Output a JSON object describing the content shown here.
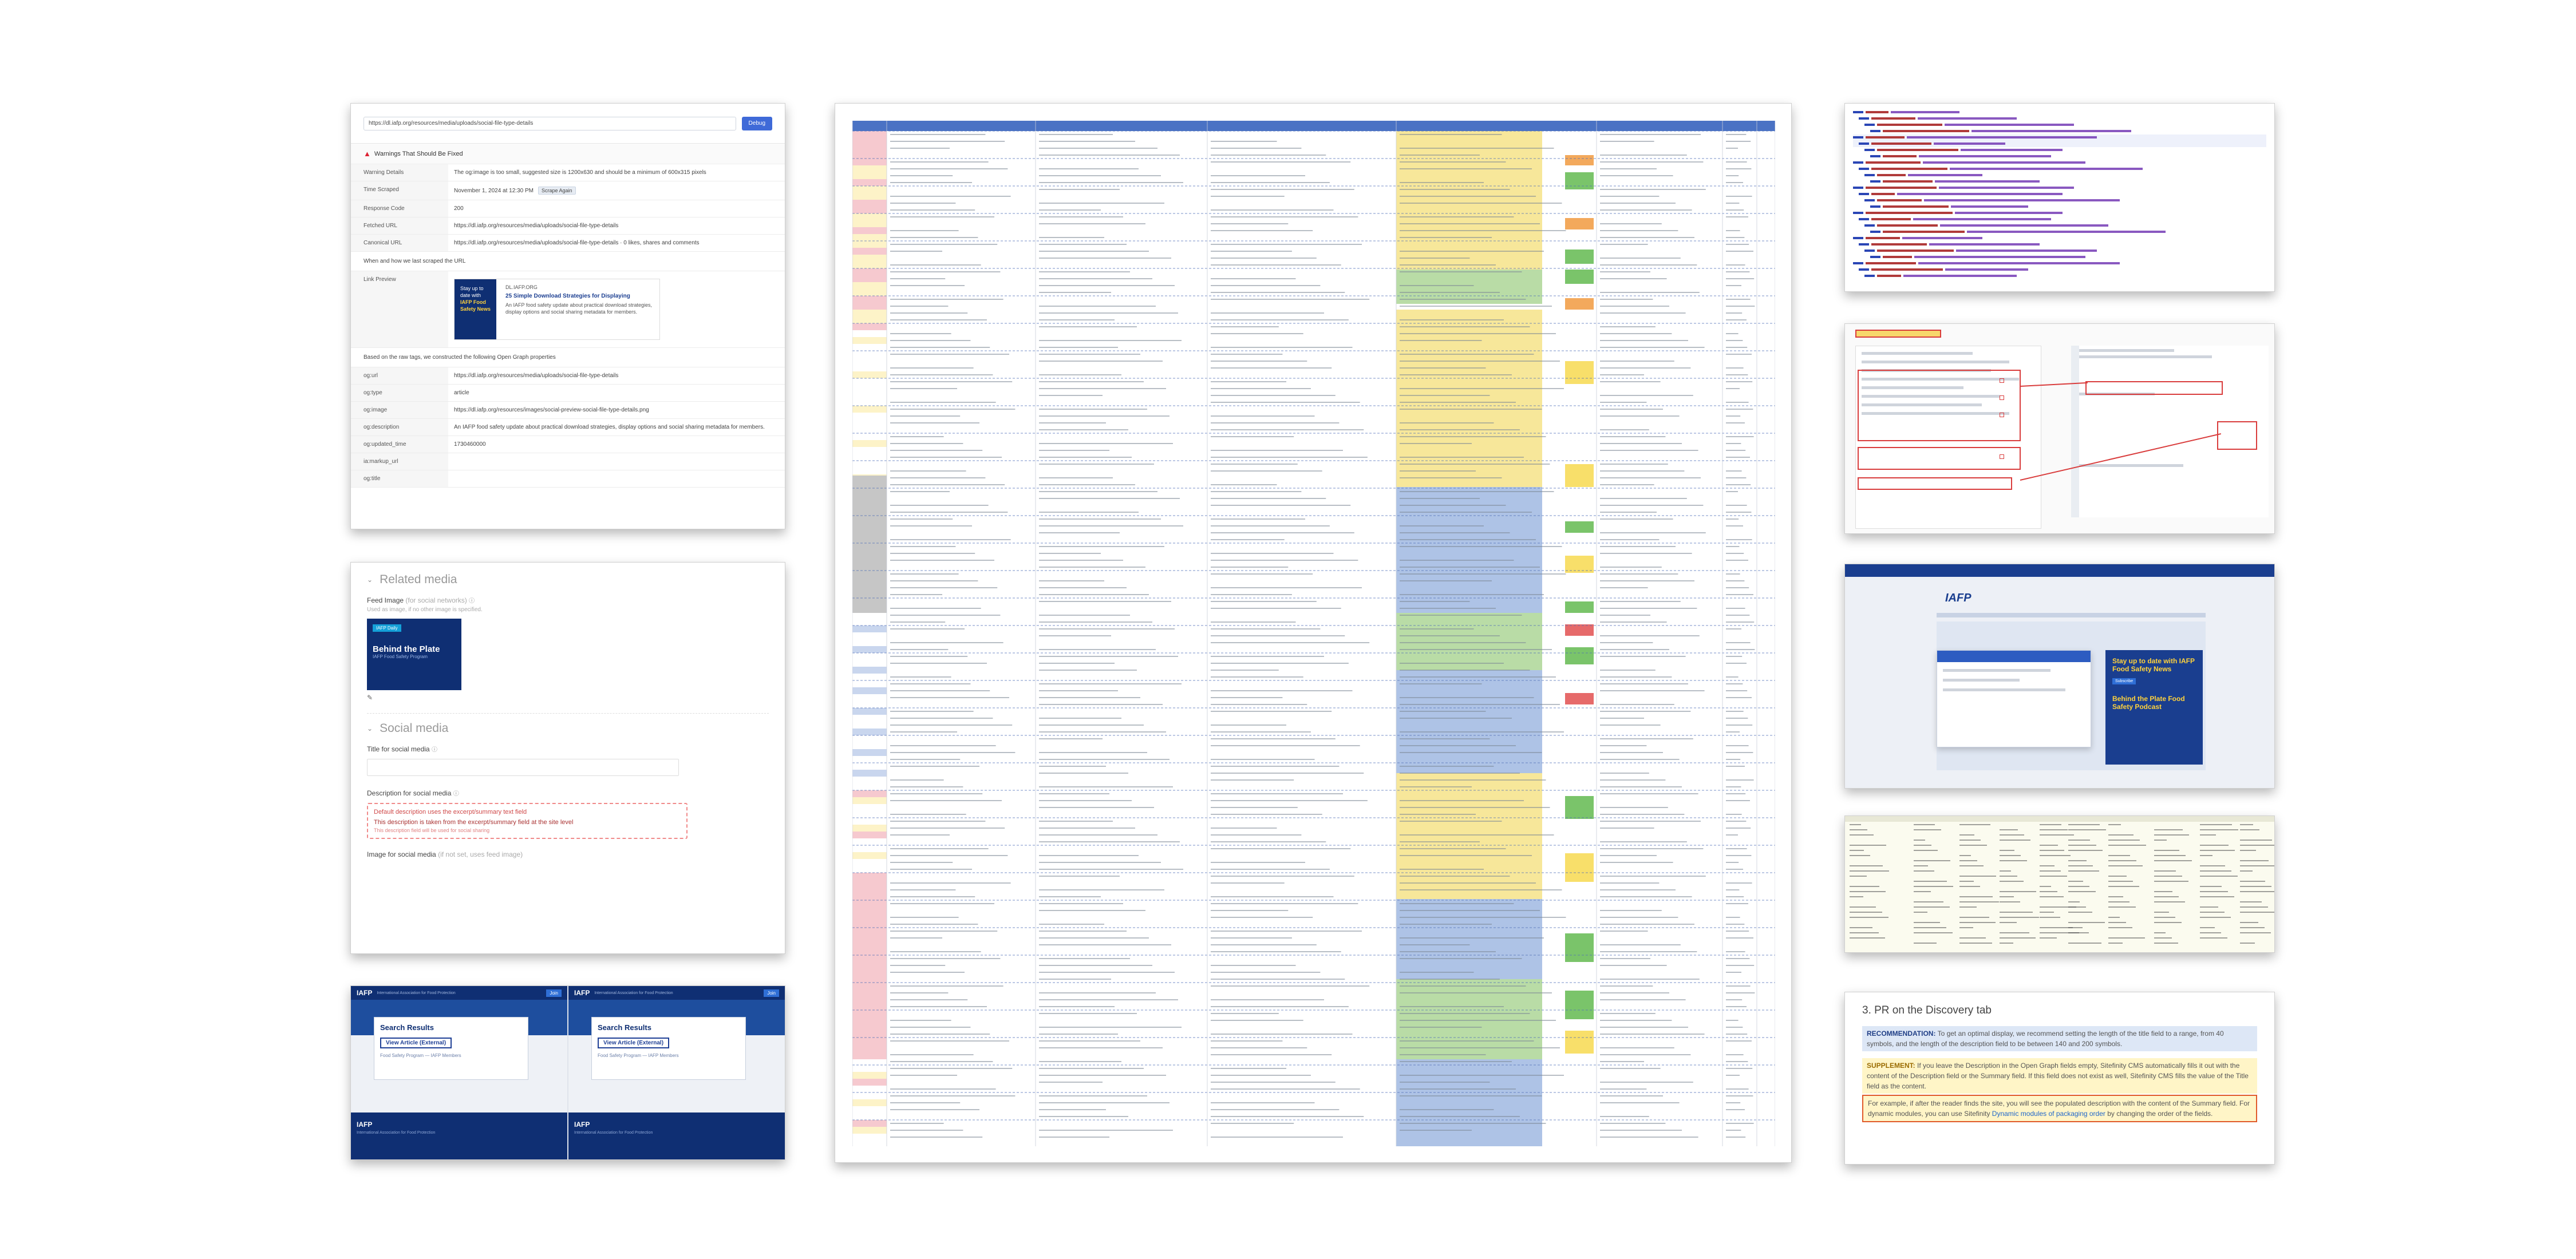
{
  "metadata_panel": {
    "url_value": "https://dl.iafp.org/resources/media/uploads/social-file-type-details",
    "fetch_button": "Debug",
    "warning": "Warnings That Should Be Fixed",
    "rows": [
      {
        "key": "Warning Details",
        "value": "The og:image is too small, suggested size is 1200x630 and should be a minimum of 600x315 pixels"
      },
      {
        "key": "Time Scraped",
        "value": "November 1, 2024 at 12:30 PM",
        "tag": "Scrape Again"
      },
      {
        "key": "Response Code",
        "value": "200"
      },
      {
        "key": "Fetched URL",
        "value": "https://dl.iafp.org/resources/media/uploads/social-file-type-details"
      },
      {
        "key": "Canonical URL",
        "value": "https://dl.iafp.org/resources/media/uploads/social-file-type-details · 0 likes, shares and comments"
      }
    ],
    "section_raw": "When and how we last scraped the URL",
    "link_preview_key": "Link Preview",
    "preview": {
      "image_lines": [
        "Stay up to",
        "date with",
        "IAFP Food",
        "Safety News"
      ],
      "site": "DL.IAFP.ORG",
      "title": "25 Simple Download Strategies for Displaying",
      "desc": "An IAFP food safety update about practical download strategies, display options and social sharing metadata for members."
    },
    "section_tags": "Based on the raw tags, we constructed the following Open Graph properties",
    "og_rows": [
      {
        "key": "og:url",
        "value": "https://dl.iafp.org/resources/media/uploads/social-file-type-details"
      },
      {
        "key": "og:type",
        "value": "article"
      },
      {
        "key": "og:image",
        "value": "https://dl.iafp.org/resources/images/social-preview-social-file-type-details.png"
      },
      {
        "key": "og:description",
        "value": "An IAFP food safety update about practical download strategies, display options and social sharing metadata for members."
      },
      {
        "key": "og:updated_time",
        "value": "1730460000"
      },
      {
        "key": "ia:markup_url",
        "value": ""
      },
      {
        "key": "og:title",
        "value": ""
      }
    ]
  },
  "media_panel": {
    "related_heading": "Related media",
    "feature_label": "Feed Image",
    "feature_muted": "(for social networks)",
    "feature_hint": "Used as image, if no other image is specified.",
    "feature_image": {
      "pill": "IAFP Daily",
      "title": "Behind the Plate",
      "subtitle": "IAFP Food Safety Program"
    },
    "social_heading": "Social media",
    "title_label": "Title for social media",
    "desc_label": "Description for social media",
    "warning_line1": "Default description uses the excerpt/summary text field",
    "warning_line2": "This description is taken from the excerpt/summary field at the site level",
    "warning_line3": "This description field will be used for social sharing",
    "image_label": "Image for social media",
    "image_muted": "(if not set, uses feed image)"
  },
  "site_panel": {
    "sites": [
      {
        "logo": "IAFP",
        "logo_sub": "International Association for Food Protection",
        "nav": "Join",
        "modal_title": "Search Results",
        "modal_button": "View Article (External)",
        "modal_link": "Food Safety Program — IAFP Members",
        "footer_logo": "IAFP",
        "footer_sub": "International Association for Food Protection"
      },
      {
        "logo": "IAFP",
        "logo_sub": "International Association for Food Protection",
        "nav": "Join",
        "modal_title": "Search Results",
        "modal_button": "View Article (External)",
        "modal_link": "Food Safety Program — IAFP Members",
        "footer_logo": "IAFP",
        "footer_sub": "International Association for Food Protection"
      }
    ]
  },
  "right_panels": {
    "site_sidebar_title": "Stay up to date with IAFP Food Safety News",
    "site_sidebar_button": "Subscribe",
    "site_sidebar_title2": "Behind the Plate Food Safety Podcast",
    "site_logo": "IAFP",
    "guidance_title": "3. PR on the Discovery tab",
    "recommendation_label": "RECOMMENDATION:",
    "recommendation_text": "To get an optimal display, we recommend setting the length of the title field to a range, from 40 symbols, and the length of the description field to be between 140 and 200 symbols.",
    "supplement_label": "SUPPLEMENT:",
    "supplement_text": "If you leave the Description in the Open Graph fields empty, Sitefinity CMS automatically fills it out with the content of the Description field or the Summary field. If this field does not exist as well, Sitefinity CMS fills the value of the Title field as the content.",
    "example_text": "For example, if after the reader finds the site, you will see the populated description with the content of the Summary field. For dynamic modules, you can use Sitefinity",
    "example_link": "Dynamic modules of packaging order",
    "example_tail": "by changing the order of the fields."
  },
  "colors": {
    "accent": "#3f6ad8",
    "brand_navy": "#0f2f73",
    "sheet_header": "#4a72c4",
    "row_pink": "#f6c9cf",
    "row_yellow": "#fdf3c8",
    "row_blue": "#c9d6ee",
    "row_gray": "#c6c6c6",
    "col_yellow": "#f7e79a",
    "col_green": "#b9dca6",
    "col_blue": "#aec3e6",
    "status_green": "#7ac46a",
    "status_orange": "#f3a95c",
    "status_yellow": "#f8df6a",
    "status_red": "#e66a6a"
  },
  "icons": {
    "warning": "warning-icon",
    "pencil": "pencil-icon",
    "collapse": "chevron-icon",
    "help": "help-icon"
  }
}
